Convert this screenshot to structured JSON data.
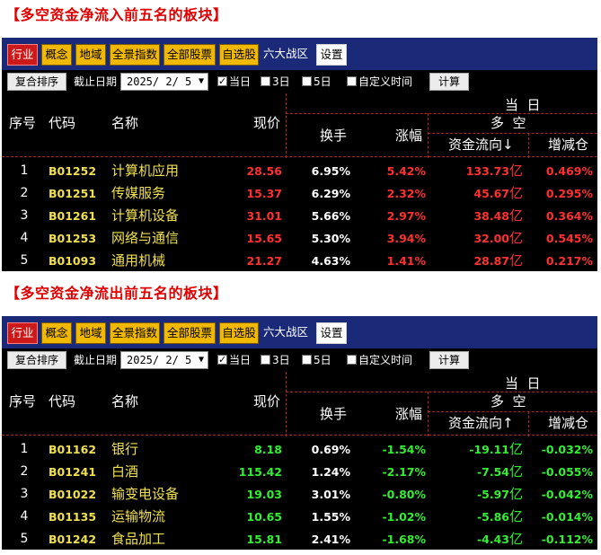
{
  "tabs": [
    "行业",
    "概念",
    "地域",
    "全景指数",
    "全部股票",
    "自选股",
    "六大战区",
    "设置"
  ],
  "toolbar": {
    "sort_button": "复合排序",
    "date_label": "截止日期",
    "date_value": "2025/ 2/ 5",
    "opt_today": "当日",
    "opt_3day": "3日",
    "opt_5day": "5日",
    "opt_custom": "自定义时间",
    "calc_button": "计算"
  },
  "headers": {
    "idx": "序号",
    "code": "代码",
    "name": "名称",
    "price": "现价",
    "today": "当  日",
    "turnover": "换手",
    "change": "涨幅",
    "longshort": "多  空",
    "flow_in": "资金流向↓",
    "flow_out": "资金流向↑",
    "position": "增减仓"
  },
  "colors": {
    "up": "#ff3030",
    "down": "#33ee33",
    "code": "#f0e050",
    "tab_bar": "#1a2a78",
    "active_tab": "#cc1a1a",
    "tab": "#f0b800"
  },
  "inflow": {
    "title": "【多空资金净流入前五名的板块】",
    "rows": [
      {
        "idx": "1",
        "code": "B01252",
        "name": "计算机应用",
        "price": "28.56",
        "turnover": "6.95%",
        "change": "5.42%",
        "flow": "133.73",
        "flow_unit": "亿",
        "position": "0.469%"
      },
      {
        "idx": "2",
        "code": "B01251",
        "name": "传媒服务",
        "price": "15.37",
        "turnover": "6.29%",
        "change": "2.32%",
        "flow": "45.67",
        "flow_unit": "亿",
        "position": "0.295%"
      },
      {
        "idx": "3",
        "code": "B01261",
        "name": "计算机设备",
        "price": "31.01",
        "turnover": "5.66%",
        "change": "2.97%",
        "flow": "38.48",
        "flow_unit": "亿",
        "position": "0.364%"
      },
      {
        "idx": "4",
        "code": "B01253",
        "name": "网络与通信",
        "price": "15.65",
        "turnover": "5.30%",
        "change": "3.94%",
        "flow": "32.00",
        "flow_unit": "亿",
        "position": "0.545%"
      },
      {
        "idx": "5",
        "code": "B01093",
        "name": "通用机械",
        "price": "21.27",
        "turnover": "4.63%",
        "change": "1.41%",
        "flow": "28.87",
        "flow_unit": "亿",
        "position": "0.217%"
      }
    ]
  },
  "outflow": {
    "title": "【多空资金净流出前五名的板块】",
    "rows": [
      {
        "idx": "1",
        "code": "B01162",
        "name": "银行",
        "price": "8.18",
        "turnover": "0.69%",
        "change": "-1.54%",
        "flow": "-19.11",
        "flow_unit": "亿",
        "position": "-0.032%"
      },
      {
        "idx": "2",
        "code": "B01241",
        "name": "白酒",
        "price": "115.42",
        "turnover": "1.24%",
        "change": "-2.17%",
        "flow": "-7.54",
        "flow_unit": "亿",
        "position": "-0.055%"
      },
      {
        "idx": "3",
        "code": "B01022",
        "name": "输变电设备",
        "price": "19.03",
        "turnover": "3.01%",
        "change": "-0.80%",
        "flow": "-5.97",
        "flow_unit": "亿",
        "position": "-0.042%"
      },
      {
        "idx": "4",
        "code": "B01135",
        "name": "运输物流",
        "price": "10.65",
        "turnover": "1.55%",
        "change": "-1.02%",
        "flow": "-5.86",
        "flow_unit": "亿",
        "position": "-0.014%"
      },
      {
        "idx": "5",
        "code": "B01242",
        "name": "食品加工",
        "price": "15.81",
        "turnover": "2.41%",
        "change": "-1.68%",
        "flow": "-4.43",
        "flow_unit": "亿",
        "position": "-0.112%"
      }
    ]
  }
}
